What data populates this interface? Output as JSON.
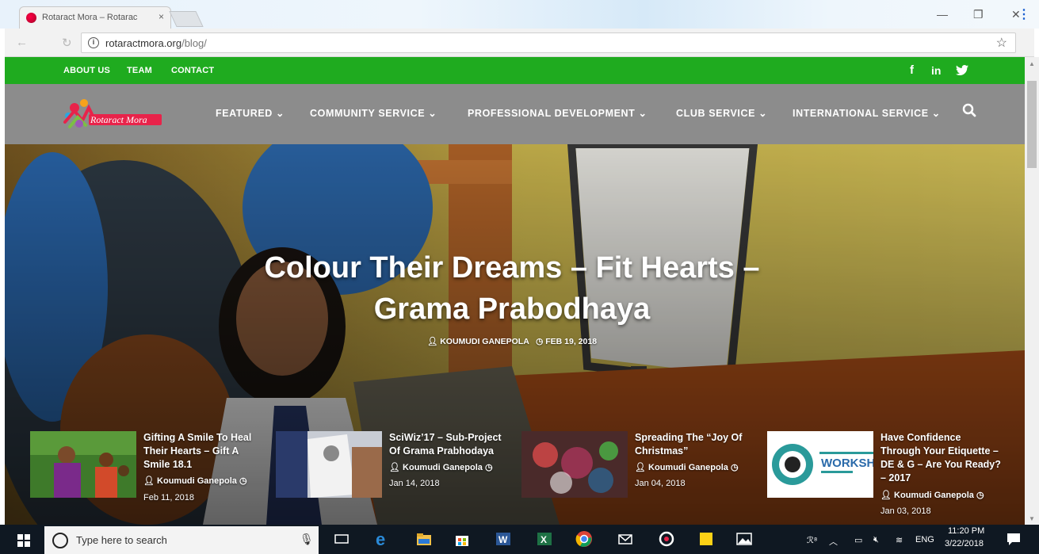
{
  "browser": {
    "tab_title": "Rotaract Mora – Rotarac",
    "tab_close": "×",
    "url_host": "rotaractmora.org",
    "url_path": "/blog/",
    "window_controls": {
      "minimize": "—",
      "maximize": "❐",
      "close": "✕"
    }
  },
  "topbar": {
    "links": [
      "ABOUT US",
      "TEAM",
      "CONTACT"
    ],
    "social": [
      "f",
      "in",
      "twitter-icon"
    ],
    "color": "#1fab1f"
  },
  "site": {
    "logo_text": "Rotaract Mora"
  },
  "mainnav": {
    "items": [
      "FEATURED",
      "COMMUNITY SERVICE",
      "PROFESSIONAL DEVELOPMENT",
      "CLUB SERVICE",
      "INTERNATIONAL SERVICE"
    ],
    "background": "#8c8c8c"
  },
  "hero": {
    "title": "Colour Their Dreams – Fit Hearts – Grama Prabodhaya",
    "author": "KOUMUDI GANEPOLA",
    "date": "FEB 19, 2018"
  },
  "cards": [
    {
      "title": "Gifting A Smile To Heal Their Hearts – Gift A Smile 18.1",
      "author": "Koumudi Ganepola",
      "date": "Feb 11, 2018"
    },
    {
      "title": "SciWiz’17 – Sub-Project Of Grama Prabhodaya",
      "author": "Koumudi Ganepola",
      "date": "Jan 14, 2018"
    },
    {
      "title": "Spreading The “Joy Of Christmas”",
      "author": "Koumudi Ganepola",
      "date": "Jan 04, 2018"
    },
    {
      "title": "Have Confidence Through Your Etiquette – DE & G – Are You Ready? – 2017",
      "author": "Koumudi Ganepola",
      "date": "Jan 03, 2018",
      "thumb_text": "WORKSHO"
    }
  ],
  "taskbar": {
    "search_placeholder": "Type here to search",
    "lang": "ENG",
    "time": "11:20 PM",
    "date": "3/22/2018"
  }
}
